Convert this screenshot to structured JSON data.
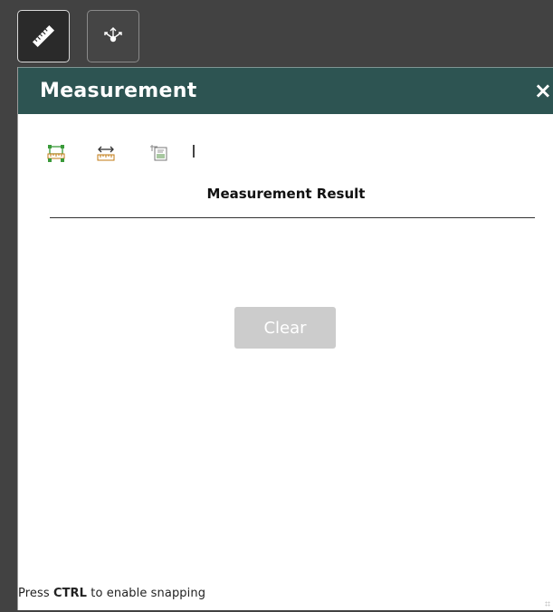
{
  "toolbar": {
    "buttons": [
      {
        "name": "measure",
        "icon": "ruler-icon",
        "active": true
      },
      {
        "name": "locate",
        "icon": "move-arrows-icon",
        "active": false
      }
    ]
  },
  "panel": {
    "title": "Measurement",
    "close_label": "×",
    "header_color": "#2d5452",
    "tools": [
      {
        "icon": "area-measure-icon"
      },
      {
        "icon": "distance-measure-icon"
      },
      {
        "icon": "coordinate-location-icon"
      }
    ],
    "result_title": "Measurement Result",
    "clear_label": "Clear",
    "hint": {
      "prefix": "Press ",
      "key": "CTRL",
      "suffix": " to enable snapping"
    }
  }
}
